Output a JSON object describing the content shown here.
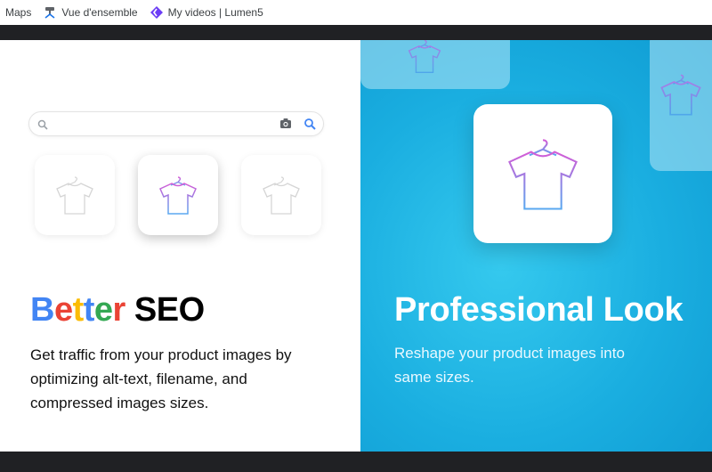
{
  "bookmarks": [
    {
      "label": "Maps",
      "icon": "maps-icon"
    },
    {
      "label": "Vue d'ensemble",
      "icon": "overview-icon"
    },
    {
      "label": "My videos | Lumen5",
      "icon": "lumen5-icon"
    }
  ],
  "search": {
    "placeholder": "",
    "value": ""
  },
  "left": {
    "title_parts": [
      "B",
      "e",
      "t",
      "t",
      "e",
      "r"
    ],
    "title_colors": [
      "#4285F4",
      "#EA4335",
      "#FBBC05",
      "#4285F4",
      "#34A853",
      "#EA4335"
    ],
    "title_rest": "SEO",
    "description": "Get traffic from your product images by optimizing alt-text, filename, and compressed images sizes."
  },
  "right": {
    "title": "Professional Look",
    "description": "Reshape your product images into same sizes."
  },
  "colors": {
    "accent_blue": "#1aaee0",
    "shirt_gradient_top": "#d45bd6",
    "shirt_gradient_bottom": "#5aa8f0",
    "shirt_gray": "#d5d5d5"
  }
}
